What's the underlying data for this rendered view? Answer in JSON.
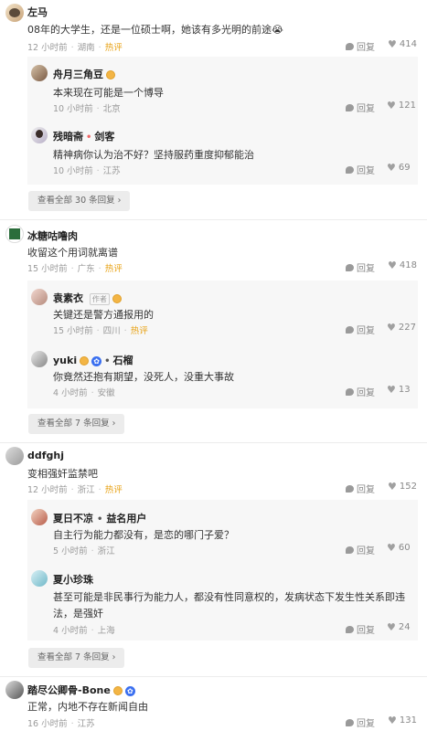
{
  "comments": [
    {
      "name": "左马",
      "text": "08年的大学生，还是一位硕士啊，她该有多光明的前途😭",
      "time": "12 小时前",
      "location": "湖南",
      "hot": "热评",
      "reply": "回复",
      "likes": "414",
      "replies": [
        {
          "name": "舟月三角豆",
          "text": "本来现在可能是一个博导",
          "time": "10 小时前",
          "location": "北京",
          "reply": "回复",
          "likes": "121"
        },
        {
          "name": "残暗斋",
          "name2": "剑客",
          "text": "精神病你认为治不好？坚持服药重度抑郁能治",
          "time": "10 小时前",
          "location": "江苏",
          "reply": "回复",
          "likes": "69"
        }
      ],
      "more": "查看全部 30 条回复"
    },
    {
      "name": "冰糖咕噜肉",
      "text": "收留这个用词就离谱",
      "time": "15 小时前",
      "location": "广东",
      "hot": "热评",
      "reply": "回复",
      "likes": "418",
      "replies": [
        {
          "name": "袁素衣",
          "tag": "作者",
          "text": "关键还是警方通报用的",
          "time": "15 小时前",
          "location": "四川",
          "hot": "热评",
          "reply": "回复",
          "likes": "227"
        },
        {
          "name": "yuki",
          "name2": "石榴",
          "text": "你竟然还抱有期望，没死人，没重大事故",
          "time": "4 小时前",
          "location": "安徽",
          "reply": "回复",
          "likes": "13"
        }
      ],
      "more": "查看全部 7 条回复"
    },
    {
      "name": "ddfghj",
      "text": "变相强奸监禁吧",
      "time": "12 小时前",
      "location": "浙江",
      "hot": "热评",
      "reply": "回复",
      "likes": "152",
      "replies": [
        {
          "name": "夏日不凉",
          "name2": "益名用户",
          "text": "自主行为能力都没有，是恋的哪门子爱？",
          "time": "5 小时前",
          "location": "浙江",
          "reply": "回复",
          "likes": "60"
        },
        {
          "name": "夏小珍珠",
          "text": "甚至可能是非民事行为能力人，都没有性同意权的，发病状态下发生性关系即违",
          "text2": "法，是强奸",
          "time": "4 小时前",
          "location": "上海",
          "reply": "回复",
          "likes": "24"
        }
      ],
      "more": "查看全部 7 条回复"
    },
    {
      "name": "踏尽公卿骨-Bone",
      "text": "正常，内地不存在新闻自由",
      "time": "16 小时前",
      "location": "江苏",
      "reply": "回复",
      "likes": "131"
    }
  ],
  "icons": {
    "reply": "reply-bubble-icon",
    "like": "heart-icon",
    "more": "chevron-right-icon"
  },
  "colors": {
    "hot": "#e8a317",
    "subbox": "#f7f7f7",
    "button": "#ececec"
  }
}
